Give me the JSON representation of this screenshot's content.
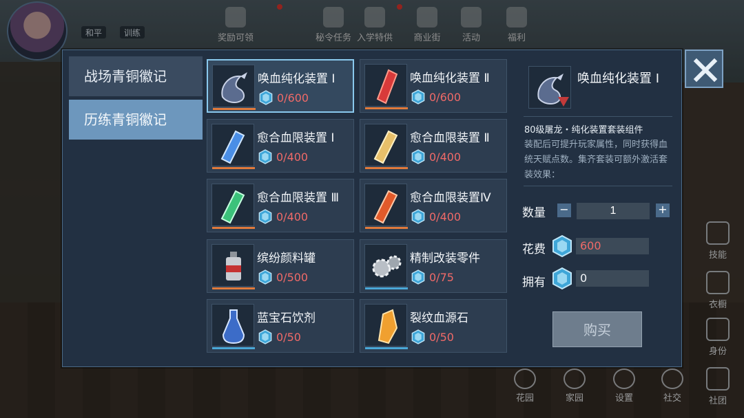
{
  "hud": {
    "chips": [
      "和平",
      "训练"
    ],
    "top_icons": [
      "奖励可领",
      "秘令任务",
      "入学特供",
      "商业街",
      "活动",
      "福利"
    ],
    "right_rail": [
      "技能",
      "衣橱",
      "身份",
      "社团"
    ],
    "bottom_bar": [
      "花园",
      "家园",
      "设置",
      "社交"
    ]
  },
  "tabs": [
    {
      "label": "战场青铜徽记",
      "active": false
    },
    {
      "label": "历练青铜徽记",
      "active": true
    }
  ],
  "items": [
    {
      "name": "唤血纯化装置 Ⅰ",
      "cost": "0/600",
      "icon": "dragon-emblem",
      "bar": "#e07a3c",
      "selected": true
    },
    {
      "name": "唤血纯化装置 Ⅱ",
      "cost": "0/600",
      "icon": "red-crystal",
      "bar": "#e07a3c",
      "selected": false
    },
    {
      "name": "愈合血限装置 Ⅰ",
      "cost": "0/400",
      "icon": "blue-crystal",
      "bar": "#e07a3c",
      "selected": false
    },
    {
      "name": "愈合血限装置 Ⅱ",
      "cost": "0/400",
      "icon": "gold-crystal",
      "bar": "#e07a3c",
      "selected": false
    },
    {
      "name": "愈合血限装置 Ⅲ",
      "cost": "0/400",
      "icon": "green-crystal",
      "bar": "#e07a3c",
      "selected": false
    },
    {
      "name": "愈合血限装置Ⅳ",
      "cost": "0/400",
      "icon": "orange-crystal",
      "bar": "#e07a3c",
      "selected": false
    },
    {
      "name": "缤纷颜料罐",
      "cost": "0/500",
      "icon": "paint-can",
      "bar": "#e07a3c",
      "selected": false
    },
    {
      "name": "精制改装零件",
      "cost": "0/75",
      "icon": "gear-parts",
      "bar": "#4aa8d8",
      "selected": false
    },
    {
      "name": "蓝宝石饮剂",
      "cost": "0/50",
      "icon": "potion-flask",
      "bar": "#4aa8d8",
      "selected": false
    },
    {
      "name": "裂纹血源石",
      "cost": "0/50",
      "icon": "amber-stone",
      "bar": "#4aa8d8",
      "selected": false
    }
  ],
  "detail": {
    "title": "唤血纯化装置 Ⅰ",
    "desc_title": "80级屠龙・纯化装置套装组件",
    "desc_body": "装配后可提升玩家属性，同时获得血统天赋点数。集齐套装可额外激活套装效果：",
    "qty_label": "数量",
    "qty_value": "1",
    "cost_label": "花费",
    "cost_value": "600",
    "own_label": "拥有",
    "own_value": "0",
    "buy_label": "购买"
  },
  "colors": {
    "cost_red": "#f06a68",
    "tab_active": "#6d97bd",
    "accent_border": "#8ac9ee"
  }
}
